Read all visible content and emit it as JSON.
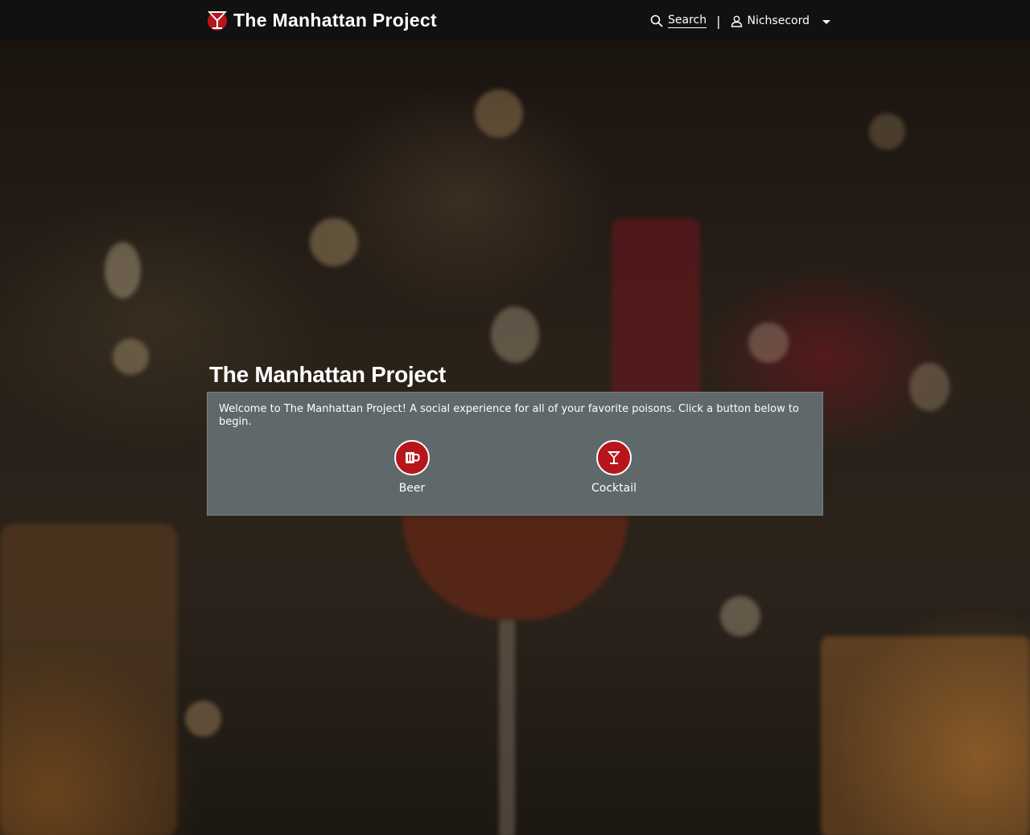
{
  "navbar": {
    "brand_title": "The Manhattan Project",
    "search_label": "Search",
    "separator": "|",
    "username": "Nichsecord"
  },
  "welcome": {
    "heading": "The Manhattan Project",
    "message": "Welcome to The Manhattan Project! A social experience for all of your favorite poisons. Click a button below to begin.",
    "choices": [
      {
        "label": "Beer",
        "icon": "beer-mug-icon"
      },
      {
        "label": "Cocktail",
        "icon": "cocktail-glass-icon"
      }
    ]
  },
  "colors": {
    "navbar_bg": "#111111",
    "card_bg": "#5f686b",
    "accent_red": "#b7151c",
    "text": "#ffffff"
  }
}
